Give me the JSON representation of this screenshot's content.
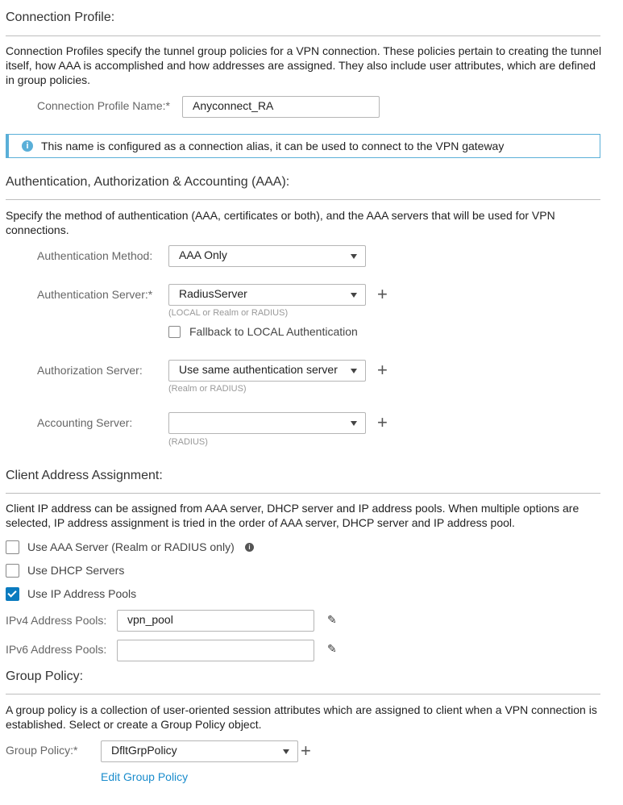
{
  "connection_profile": {
    "heading": "Connection Profile:",
    "description": "Connection Profiles specify the tunnel group policies for a VPN connection. These policies pertain to creating the tunnel itself, how AAA is accomplished and how addresses are assigned. They also include user attributes, which are defined in group policies.",
    "name_label": "Connection Profile Name:*",
    "name_value": "Anyconnect_RA",
    "info_text": "This name is configured as a connection alias, it can be used to connect to the VPN gateway"
  },
  "aaa": {
    "heading": "Authentication, Authorization & Accounting (AAA):",
    "description": "Specify the method of authentication (AAA, certificates or both), and the AAA servers that will be used for VPN connections.",
    "auth_method_label": "Authentication Method:",
    "auth_method_value": "AAA Only",
    "auth_server_label": "Authentication Server:*",
    "auth_server_value": "RadiusServer",
    "auth_server_hint": "(LOCAL or Realm or RADIUS)",
    "fallback_label": "Fallback to LOCAL Authentication",
    "fallback_checked": false,
    "authz_server_label": "Authorization Server:",
    "authz_server_value": "Use same authentication server",
    "authz_server_hint": "(Realm or RADIUS)",
    "acct_server_label": "Accounting Server:",
    "acct_server_value": "",
    "acct_server_hint": "(RADIUS)"
  },
  "client_address": {
    "heading": "Client Address Assignment:",
    "description": "Client IP address can be assigned from AAA server, DHCP server and IP address pools. When multiple options are selected, IP address assignment is tried in the order of AAA server, DHCP server and IP address pool.",
    "options": [
      {
        "label": "Use AAA Server (Realm or RADIUS only)",
        "checked": false
      },
      {
        "label": "Use DHCP Servers",
        "checked": false
      },
      {
        "label": "Use IP Address Pools",
        "checked": true
      }
    ],
    "ipv4_label": "IPv4 Address Pools:",
    "ipv4_value": "vpn_pool",
    "ipv6_label": "IPv6 Address Pools:",
    "ipv6_value": ""
  },
  "group_policy": {
    "heading": "Group Policy:",
    "description": "A group policy is a collection of user-oriented session attributes which are assigned to client when a VPN connection is established. Select or create a Group Policy object.",
    "label": "Group Policy:*",
    "value": "DfltGrpPolicy",
    "edit_link": "Edit Group Policy"
  },
  "colors": {
    "accent": "#0a7bbf",
    "info_border": "#5aafd8",
    "link": "#1a8ccc"
  }
}
